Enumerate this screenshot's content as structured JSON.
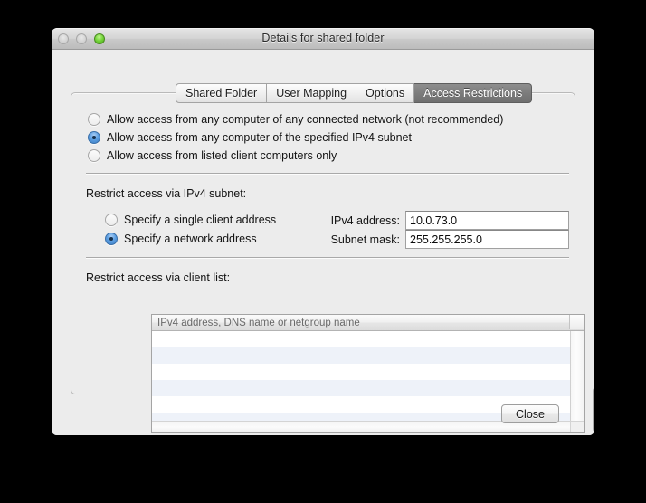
{
  "window": {
    "title": "Details for shared folder",
    "traffic_lights": [
      {
        "name": "close-button-dot",
        "state": "disabled"
      },
      {
        "name": "minimize-button-dot",
        "state": "disabled"
      },
      {
        "name": "zoom-button-dot",
        "state": "enabled"
      }
    ]
  },
  "tabs": [
    {
      "label": "Shared Folder",
      "selected": false
    },
    {
      "label": "User Mapping",
      "selected": false
    },
    {
      "label": "Options",
      "selected": false
    },
    {
      "label": "Access Restrictions",
      "selected": true
    }
  ],
  "access_mode": {
    "options": [
      {
        "label": "Allow access from any computer of any connected network (not recommended)",
        "selected": false
      },
      {
        "label": "Allow access from any computer of the specified IPv4 subnet",
        "selected": true
      },
      {
        "label": "Allow access from listed client computers only",
        "selected": false
      }
    ]
  },
  "subnet_section": {
    "heading": "Restrict access via IPv4 subnet:",
    "options": [
      {
        "label": "Specify a single client address",
        "selected": false
      },
      {
        "label": "Specify a network address",
        "selected": true
      }
    ],
    "fields": [
      {
        "label": "IPv4 address:",
        "value": "10.0.73.0",
        "placeholder": ""
      },
      {
        "label": "Subnet mask:",
        "value": "255.255.255.0",
        "placeholder": ""
      }
    ]
  },
  "client_list_section": {
    "heading": "Restrict access via client list:",
    "column_header": "IPv4 address, DNS name or netgroup name",
    "rows": [],
    "row_count_visible": 6,
    "add_button_label": "+",
    "remove_button_label": "−"
  },
  "footer": {
    "close_label": "Close"
  },
  "colors": {
    "window_background": "#ececec",
    "selected_tab_background": "#7c7c7c",
    "selected_radio": "#5d9fe2",
    "table_alt_row": "#eef2f9",
    "zoom_light": "#74d43a"
  }
}
